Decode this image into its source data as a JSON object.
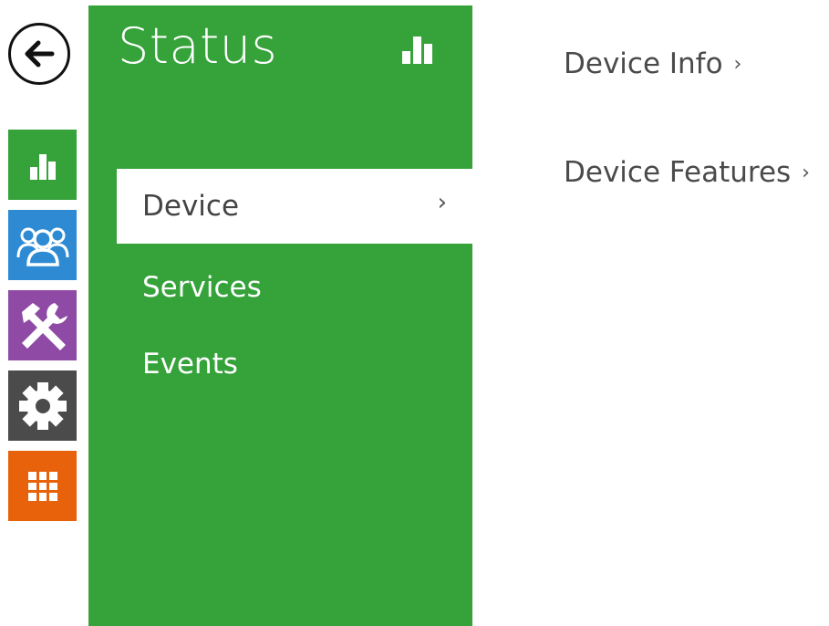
{
  "header": {
    "back_icon": "arrow-left-icon"
  },
  "rail": {
    "items": [
      {
        "icon": "bar-chart-icon",
        "color": "#35a23a"
      },
      {
        "icon": "users-icon",
        "color": "#2e8bd3"
      },
      {
        "icon": "tools-icon",
        "color": "#8e4aa5"
      },
      {
        "icon": "gear-icon",
        "color": "#4b4b4b"
      },
      {
        "icon": "grid-icon",
        "color": "#e8620c"
      }
    ]
  },
  "panel": {
    "title": "Status",
    "title_icon": "bar-chart-icon",
    "color": "#35a23a",
    "nav": [
      {
        "label": "Device",
        "active": true
      },
      {
        "label": "Services",
        "active": false
      },
      {
        "label": "Events",
        "active": false
      }
    ],
    "active_chevron": "›"
  },
  "content": {
    "links": [
      {
        "label": "Device Info",
        "chevron": "›"
      },
      {
        "label": "Device Features",
        "chevron": "›"
      }
    ]
  }
}
